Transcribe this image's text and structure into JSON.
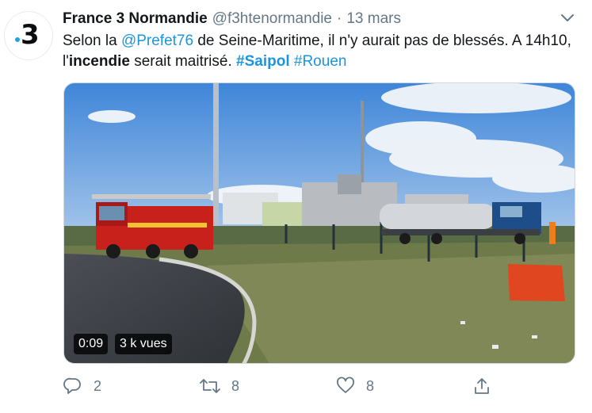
{
  "tweet": {
    "author": {
      "name": "France 3 Normandie",
      "handle": "@f3htenormandie",
      "avatar_digit": "3"
    },
    "separator": "·",
    "date": "13 mars",
    "text": {
      "part1": "Selon la ",
      "mention": "@Prefet76",
      "part2": " de Seine-Maritime, il n'y aurait pas de blessés. A 14h10, l'",
      "bold": "incendie",
      "part3": " serait maitrisé. ",
      "hashtag1": "#Saipol",
      "hashtag2": "#Rouen"
    },
    "video": {
      "duration": "0:09",
      "views": "3 k vues"
    },
    "actions": {
      "replies": "2",
      "retweets": "8",
      "likes": "8"
    }
  },
  "colors": {
    "link": "#1b95e0",
    "secondary_text": "#657786",
    "brand_dot": "#1da1f2"
  },
  "icons": [
    "chevron-down-icon",
    "reply-icon",
    "retweet-icon",
    "like-icon",
    "share-icon"
  ]
}
